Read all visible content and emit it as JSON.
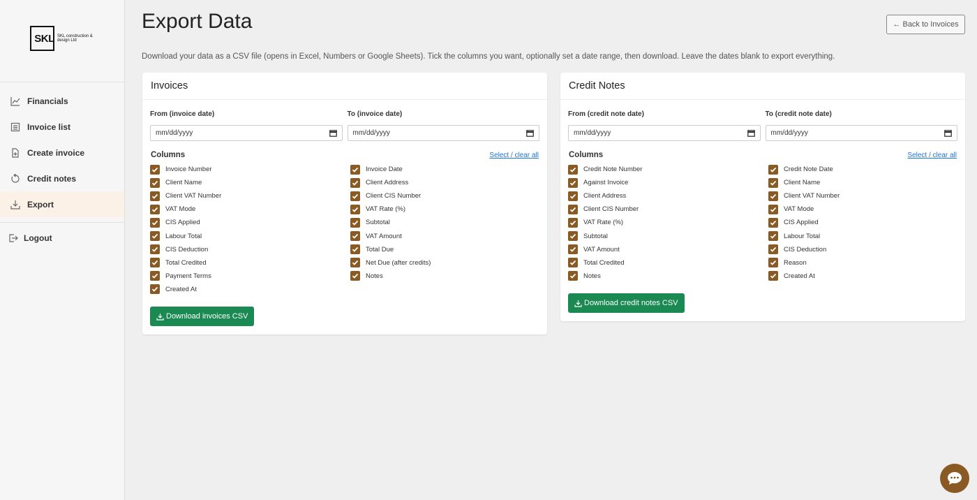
{
  "logo": {
    "mark": "SKL",
    "text": "SKL construction & design Ltd"
  },
  "sidebar": {
    "items": [
      {
        "label": "Financials",
        "icon": "chart-line-icon"
      },
      {
        "label": "Invoice list",
        "icon": "list-icon"
      },
      {
        "label": "Create invoice",
        "icon": "file-plus-icon"
      },
      {
        "label": "Credit notes",
        "icon": "refund-icon"
      },
      {
        "label": "Export",
        "icon": "download-icon",
        "active": true
      }
    ],
    "logout": "Logout"
  },
  "header": {
    "title": "Export Data",
    "back_label": "← Back to Invoices",
    "intro": "Download your data as a CSV file (opens in Excel, Numbers or Google Sheets). Tick the columns you want, optionally set a date range, then download. Leave the dates blank to export everything."
  },
  "invoices": {
    "title": "Invoices",
    "from_label": "From (invoice date)",
    "to_label": "To (invoice date)",
    "from_value": "mm/dd/yyyy",
    "to_value": "mm/dd/yyyy",
    "columns_title": "Columns",
    "select_all": "Select / clear all",
    "columns": [
      "Invoice Number",
      "Invoice Date",
      "Client Name",
      "Client Address",
      "Client VAT Number",
      "Client CIS Number",
      "VAT Mode",
      "VAT Rate (%)",
      "CIS Applied",
      "Subtotal",
      "Labour Total",
      "VAT Amount",
      "CIS Deduction",
      "Total Due",
      "Total Credited",
      "Net Due (after credits)",
      "Payment Terms",
      "Notes",
      "Created At"
    ],
    "download_label": "Download invoices CSV"
  },
  "credit": {
    "title": "Credit Notes",
    "from_label": "From (credit note date)",
    "to_label": "To (credit note date)",
    "from_value": "mm/dd/yyyy",
    "to_value": "mm/dd/yyyy",
    "columns_title": "Columns",
    "select_all": "Select / clear all",
    "columns": [
      "Credit Note Number",
      "Credit Note Date",
      "Against Invoice",
      "Client Name",
      "Client Address",
      "Client VAT Number",
      "Client CIS Number",
      "VAT Mode",
      "VAT Rate (%)",
      "CIS Applied",
      "Subtotal",
      "Labour Total",
      "VAT Amount",
      "CIS Deduction",
      "Total Credited",
      "Reason",
      "Notes",
      "Created At"
    ],
    "download_label": "Download credit notes CSV"
  },
  "colors": {
    "accent": "#8a5a24",
    "download": "#1a8a52",
    "link": "#1a73d9"
  }
}
